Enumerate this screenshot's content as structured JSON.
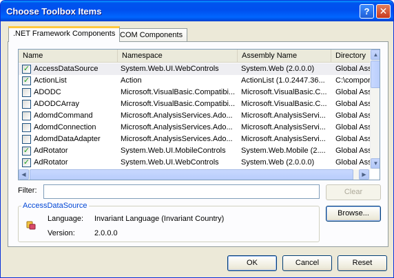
{
  "window": {
    "title": "Choose Toolbox Items",
    "help_glyph": "?",
    "close_glyph": "✕"
  },
  "tabs": [
    {
      "label": ".NET Framework Components"
    },
    {
      "label": "COM Components"
    }
  ],
  "list": {
    "columns": [
      "Name",
      "Namespace",
      "Assembly Name",
      "Directory"
    ],
    "rows": [
      {
        "checked": true,
        "name": "AccessDataSource",
        "namespace": "System.Web.UI.WebControls",
        "assembly": "System.Web (2.0.0.0)",
        "directory": "Global Ass"
      },
      {
        "checked": true,
        "name": "ActionList",
        "namespace": "Action",
        "assembly": "ActionList (1.0.2447.36...",
        "directory": "C:\\compor"
      },
      {
        "checked": false,
        "name": "ADODC",
        "namespace": "Microsoft.VisualBasic.Compatibi...",
        "assembly": "Microsoft.VisualBasic.C...",
        "directory": "Global Ass"
      },
      {
        "checked": false,
        "name": "ADODCArray",
        "namespace": "Microsoft.VisualBasic.Compatibi...",
        "assembly": "Microsoft.VisualBasic.C...",
        "directory": "Global Ass"
      },
      {
        "checked": false,
        "name": "AdomdCommand",
        "namespace": "Microsoft.AnalysisServices.Ado...",
        "assembly": "Microsoft.AnalysisServi...",
        "directory": "Global Ass"
      },
      {
        "checked": false,
        "name": "AdomdConnection",
        "namespace": "Microsoft.AnalysisServices.Ado...",
        "assembly": "Microsoft.AnalysisServi...",
        "directory": "Global Ass"
      },
      {
        "checked": false,
        "name": "AdomdDataAdapter",
        "namespace": "Microsoft.AnalysisServices.Ado...",
        "assembly": "Microsoft.AnalysisServi...",
        "directory": "Global Ass"
      },
      {
        "checked": true,
        "name": "AdRotator",
        "namespace": "System.Web.UI.MobileControls",
        "assembly": "System.Web.Mobile (2....",
        "directory": "Global Ass"
      },
      {
        "checked": true,
        "name": "AdRotator",
        "namespace": "System.Web.UI.WebControls",
        "assembly": "System.Web (2.0.0.0)",
        "directory": "Global Ass"
      }
    ],
    "selected_index": 0,
    "check_glyph": "✓"
  },
  "filter": {
    "label": "Filter:",
    "value": "",
    "clear_label": "Clear"
  },
  "details": {
    "group_title": "AccessDataSource",
    "language_label": "Language:",
    "language_value": "Invariant Language (Invariant Country)",
    "version_label": "Version:",
    "version_value": "2.0.0.0",
    "browse_label": "Browse..."
  },
  "footer": {
    "ok_label": "OK",
    "cancel_label": "Cancel",
    "reset_label": "Reset"
  },
  "scroll": {
    "up": "▲",
    "down": "▼",
    "left": "◀",
    "right": "▶"
  }
}
